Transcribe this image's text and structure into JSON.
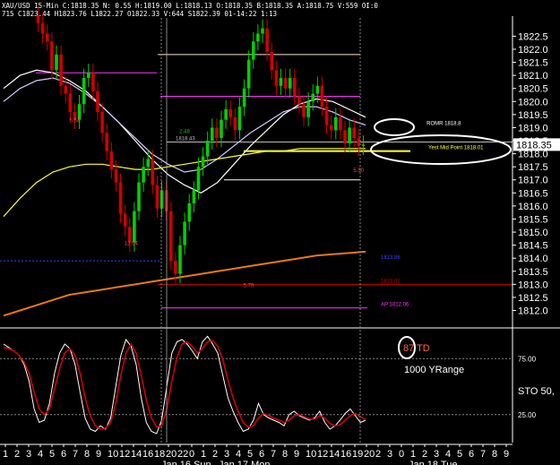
{
  "header": {
    "line1": "XAU/USD  15-Min  C:1818.35  N:  0.55  H:1819.00  L:1818.13  O:1818.35  B:1818.35  A:1818.75  V:559  OI:0",
    "line2": "715  C1823.44  H1823.76  L1822.27  O1822.33  V:644  S1822.39  01-14:22  1:13"
  },
  "colors": {
    "background": "#000000",
    "up": "#00d000",
    "down": "#d00000",
    "ma_white": "#ffffff",
    "ma_lavender": "#d8c8ff",
    "ma_yellow": "#ffff33",
    "ma_orange": "#e87a10",
    "magenta": "#ff33ff",
    "stoch_fast": "#ffffff",
    "stoch_slow": "#d00000"
  },
  "chart_data": [
    {
      "type": "candlestick",
      "title": "XAU/USD 15-Min",
      "ylim": [
        1811.4,
        1823.2
      ],
      "y_ticks": [
        1812.0,
        1812.5,
        1813.0,
        1813.5,
        1814.0,
        1814.5,
        1815.0,
        1815.5,
        1816.0,
        1816.5,
        1817.0,
        1817.5,
        1818.0,
        1818.5,
        1819.0,
        1819.5,
        1820.0,
        1820.5,
        1821.0,
        1821.5,
        1822.0,
        1822.5
      ],
      "y_tick_labels": [
        "1812.0",
        "1812.5",
        "1813.0",
        "1813.5",
        "1814.0",
        "1814.5",
        "1815.0",
        "1815.5",
        "1816.0",
        "1816.5",
        "1817.0",
        "1817.5",
        "1818.0",
        "1818.5",
        "1819.0",
        "1819.5",
        "1820.0",
        "1820.5",
        "1821.0",
        "1821.5",
        "1822.0",
        "1822.5"
      ],
      "x_tick_labels": [
        "1",
        "2",
        "3",
        "4",
        "5",
        "6",
        "7",
        "8",
        "9",
        "10",
        "12",
        "14",
        "16",
        "18",
        "20",
        "22",
        "0",
        "1",
        "2",
        "3",
        "4",
        "5",
        "6",
        "7",
        "8",
        "9",
        "10",
        "12",
        "14",
        "16",
        "19",
        "20",
        "2",
        "3",
        "0",
        "1",
        "2",
        "3",
        "4",
        "5",
        "6",
        "7",
        "8",
        "9"
      ],
      "date_labels": [
        "Jan 16 Sun",
        "Jan 17 Mon",
        "Jan 18 Tue"
      ],
      "last_price": "1818.35",
      "closes": [
        1823.0,
        1822.6,
        1822.3,
        1821.2,
        1821.8,
        1820.6,
        1820.3,
        1819.6,
        1819.3,
        1819.9,
        1820.9,
        1821.1,
        1820.4,
        1819.6,
        1818.8,
        1818.1,
        1817.4,
        1816.9,
        1815.7,
        1815.2,
        1814.6,
        1815.8,
        1816.9,
        1817.5,
        1817.8,
        1816.8,
        1815.9,
        1816.6,
        1815.8,
        1813.9,
        1813.4,
        1814.5,
        1815.4,
        1816.1,
        1816.6,
        1817.5,
        1817.9,
        1818.5,
        1819.0,
        1818.6,
        1819.3,
        1819.7,
        1819.4,
        1818.9,
        1819.8,
        1820.5,
        1821.6,
        1822.3,
        1822.6,
        1822.8,
        1821.9,
        1821.2,
        1820.6,
        1820.9,
        1820.5,
        1820.9,
        1820.2,
        1819.9,
        1819.4,
        1820.0,
        1820.3,
        1820.6,
        1819.8,
        1819.1,
        1818.9,
        1819.4,
        1818.9,
        1818.4,
        1819.0,
        1818.6,
        1818.3,
        1818.35
      ],
      "moving_averages": [
        {
          "color": "#ffffff",
          "values": [
            1820.5,
            1821.0,
            1821.2,
            1821.1,
            1820.8,
            1820.4,
            1819.8,
            1819.2,
            1818.5,
            1817.8,
            1817.2,
            1816.8,
            1816.5,
            1816.9,
            1817.6,
            1818.3,
            1818.9,
            1819.5,
            1819.9,
            1820.1,
            1820.0,
            1819.7,
            1819.4
          ]
        },
        {
          "color": "#d8c8ff",
          "values": [
            1820.0,
            1820.5,
            1820.8,
            1820.9,
            1820.7,
            1820.3,
            1819.8,
            1819.2,
            1818.6,
            1818.0,
            1817.6,
            1817.3,
            1817.4,
            1817.8,
            1818.3,
            1818.8,
            1819.2,
            1819.6,
            1819.8,
            1819.8,
            1819.6,
            1819.3,
            1819.1
          ]
        },
        {
          "color": "#ffff33",
          "values": [
            1815.6,
            1816.3,
            1816.9,
            1817.3,
            1817.5,
            1817.6,
            1817.6,
            1817.5,
            1817.4,
            1817.4,
            1817.5,
            1817.6,
            1817.7,
            1817.8,
            1817.9,
            1818.0,
            1818.1,
            1818.1,
            1818.2,
            1818.2,
            1818.2,
            1818.2,
            1818.2
          ]
        },
        {
          "color": "#e87a10",
          "values": [
            1811.8,
            1812.0,
            1812.2,
            1812.4,
            1812.6,
            1812.7,
            1812.8,
            1812.9,
            1813.0,
            1813.1,
            1813.2,
            1813.3,
            1813.4,
            1813.5,
            1813.6,
            1813.7,
            1813.8,
            1813.9,
            1814.0,
            1814.1,
            1814.15,
            1814.2,
            1814.25
          ]
        }
      ],
      "horizontal_levels": [
        {
          "value": 1821.1,
          "color": "#ff33ff",
          "label": ""
        },
        {
          "value": 1820.2,
          "color": "#ff33ff",
          "label": ""
        },
        {
          "value": 1821.8,
          "color": "#ffe4c8",
          "label": ""
        },
        {
          "value": 1818.45,
          "color": "#bbbbbb",
          "label": "1818.43"
        },
        {
          "value": 1818.1,
          "color": "#ffff33",
          "label": "Yest Mid Point 1818.01"
        },
        {
          "value": 1817.0,
          "color": "#ffffff",
          "label": ""
        },
        {
          "value": 1813.9,
          "color": "#3344ff",
          "label": "1813.86"
        },
        {
          "value": 1813.0,
          "color": "#d00000",
          "label": "1813.01"
        },
        {
          "value": 1812.1,
          "color": "#ff33ff",
          "label": "AP 1812.06"
        }
      ],
      "annotations": [
        {
          "text": "5.54",
          "x": 8,
          "y": 1819.2,
          "color": "#ff4444"
        },
        {
          "text": "2.48",
          "x": 32,
          "y": 1818.8,
          "color": "#00d000"
        },
        {
          "text": "12.04",
          "x": 20,
          "y": 1814.5,
          "color": "#ff4444"
        },
        {
          "text": "5.79",
          "x": 46,
          "y": 1812.9,
          "color": "#ff4444"
        },
        {
          "text": "5.50",
          "x": 70,
          "y": 1817.3,
          "color": "#ff4444"
        },
        {
          "text": "ROMR 1818.8",
          "x": 86,
          "y": 1819.1,
          "color": "#ffffff"
        }
      ],
      "callouts": [
        "Yest Mid Point 1818.01"
      ]
    },
    {
      "type": "line",
      "title": "STO",
      "ylim": [
        0,
        100
      ],
      "y_ticks": [
        25,
        75
      ],
      "y_tick_labels": [
        "25.00",
        "75.00"
      ],
      "series": [
        {
          "name": "",
          "color": "#ffffff",
          "values": [
            88,
            85,
            82,
            78,
            70,
            55,
            30,
            18,
            20,
            35,
            62,
            80,
            88,
            84,
            70,
            45,
            22,
            12,
            10,
            15,
            12,
            22,
            50,
            78,
            92,
            86,
            70,
            40,
            18,
            10,
            8,
            20,
            50,
            80,
            90,
            92,
            88,
            82,
            75,
            90,
            95,
            88,
            80,
            60,
            40,
            28,
            18,
            10,
            12,
            20,
            35,
            25,
            22,
            20,
            18,
            15,
            25,
            28,
            24,
            22,
            20,
            22,
            28,
            18,
            12,
            15,
            20,
            26,
            30,
            24,
            18,
            20
          ]
        },
        {
          "name": "",
          "color": "#d00000",
          "values": [
            85,
            84,
            82,
            78,
            72,
            62,
            45,
            30,
            25,
            30,
            48,
            66,
            80,
            84,
            78,
            62,
            40,
            24,
            15,
            12,
            13,
            18,
            35,
            60,
            80,
            88,
            80,
            60,
            38,
            22,
            14,
            15,
            30,
            55,
            76,
            88,
            90,
            86,
            80,
            84,
            90,
            91,
            86,
            74,
            56,
            40,
            28,
            18,
            14,
            15,
            22,
            26,
            24,
            22,
            20,
            18,
            20,
            24,
            25,
            23,
            21,
            21,
            24,
            22,
            17,
            15,
            16,
            20,
            24,
            26,
            23,
            21
          ]
        }
      ],
      "labels": [
        "STO  50,",
        "87 TD",
        "1000 YRange"
      ]
    }
  ]
}
